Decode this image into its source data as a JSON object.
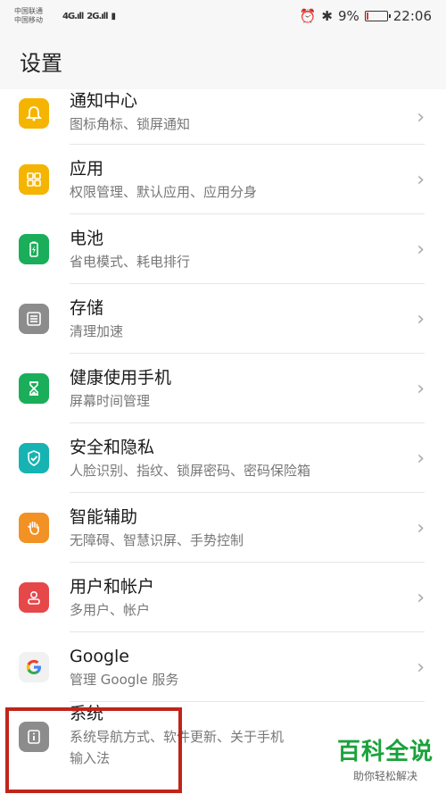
{
  "status": {
    "carrier1": "中国联通",
    "carrier2": "中国移动",
    "signal1": "4G",
    "signal2": "2G",
    "battery_text": "9%",
    "time": "22:06",
    "battery_level": 0.09
  },
  "header": {
    "title": "设置"
  },
  "rows": [
    {
      "title": "通知中心",
      "subtitle": "图标角标、锁屏通知",
      "icon": "bell-icon",
      "color": "#f5b400"
    },
    {
      "title": "应用",
      "subtitle": "权限管理、默认应用、应用分身",
      "icon": "apps-icon",
      "color": "#f5b400"
    },
    {
      "title": "电池",
      "subtitle": "省电模式、耗电排行",
      "icon": "battery-icon",
      "color": "#1aae5a"
    },
    {
      "title": "存储",
      "subtitle": "清理加速",
      "icon": "storage-icon",
      "color": "#8c8c8c"
    },
    {
      "title": "健康使用手机",
      "subtitle": "屏幕时间管理",
      "icon": "hourglass-icon",
      "color": "#1aae5a"
    },
    {
      "title": "安全和隐私",
      "subtitle": "人脸识别、指纹、锁屏密码、密码保险箱",
      "icon": "shield-icon",
      "color": "#17b3b3"
    },
    {
      "title": "智能辅助",
      "subtitle": "无障碍、智慧识屏、手势控制",
      "icon": "hand-icon",
      "color": "#f29124"
    },
    {
      "title": "用户和帐户",
      "subtitle": "多用户、帐户",
      "icon": "user-icon",
      "color": "#e6484a"
    },
    {
      "title": "Google",
      "subtitle": "管理 Google 服务",
      "icon": "google-icon",
      "color": "#888888"
    },
    {
      "title": "系统",
      "subtitle": "系统导航方式、软件更新、关于手机",
      "subtitle2": "输入法",
      "icon": "info-icon",
      "color": "#8c8c8c"
    }
  ],
  "chevron": "›",
  "watermark": {
    "main": "百科全说",
    "sub": "助你轻松解决"
  }
}
